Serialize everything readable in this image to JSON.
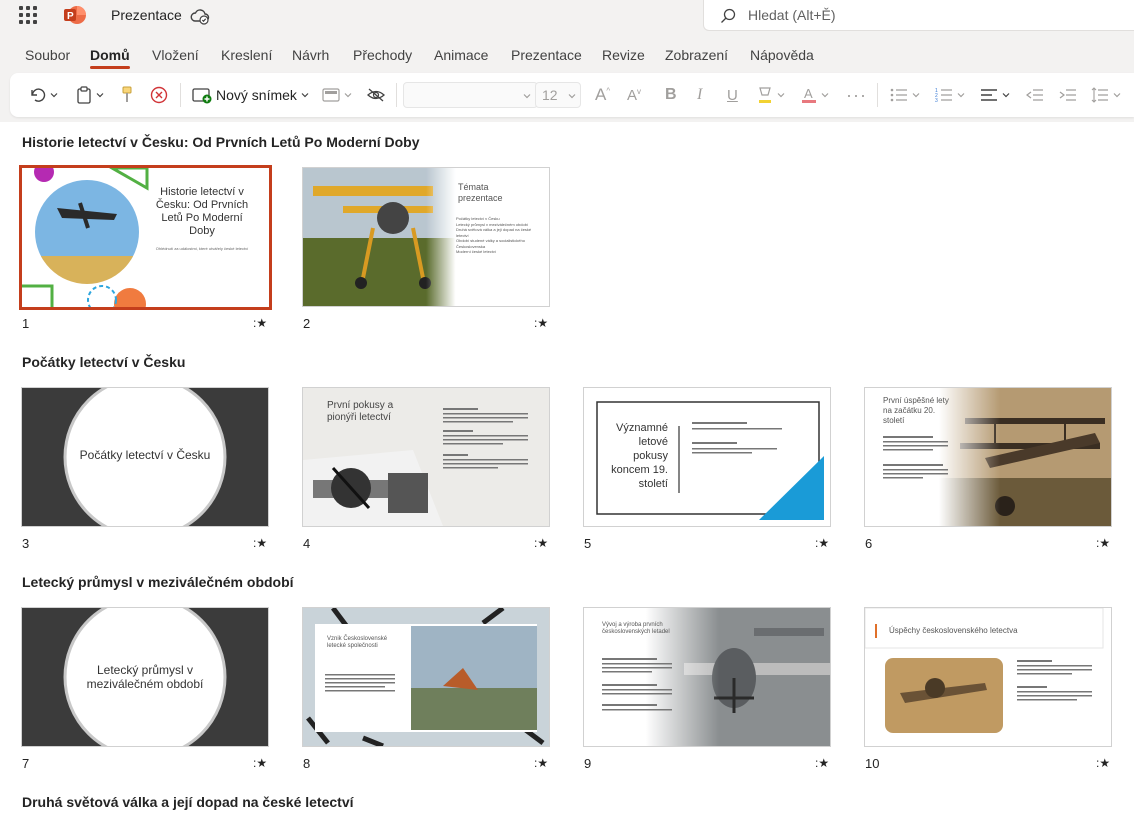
{
  "app": {
    "title": "Prezentace",
    "search_placeholder": "Hledat (Alt+Ě)"
  },
  "menu_tabs": [
    "Soubor",
    "Domů",
    "Vložení",
    "Kreslení",
    "Návrh",
    "Přechody",
    "Animace",
    "Prezentace",
    "Revize",
    "Zobrazení",
    "Nápověda"
  ],
  "active_tab": "Domů",
  "ribbon": {
    "new_slide_label": "Nový snímek",
    "font_size": "12"
  },
  "sections": [
    "Historie letectví v Česku: Od Prvních Letů Po Moderní Doby",
    "Počátky letectví v Česku",
    "Letecký průmysl v meziválečném období",
    "Druhá světová válka a její dopad na české letectví"
  ],
  "slides": [
    {
      "num": "1",
      "title": "Historie letectví v Česku: Od Prvních Letů Po Moderní Doby",
      "subtitle": "Ohlédnutí za událostmi, které utvářely české letectví"
    },
    {
      "num": "2",
      "title": "Témata prezentace",
      "bullets": [
        "Počátky letectví v Česku",
        "Letecký průmysl v meziválečném období",
        "Druhá světová válka a její dopad na české letectví",
        "Období studené války a socialistického Československa",
        "Moderní české letectví"
      ]
    },
    {
      "num": "3",
      "title": "Počátky letectví v Česku"
    },
    {
      "num": "4",
      "title": "První pokusy a pionýři letectví"
    },
    {
      "num": "5",
      "title": "Významné letové pokusy koncem 19. století"
    },
    {
      "num": "6",
      "title": "První úspěšné lety na začátku 20. století"
    },
    {
      "num": "7",
      "title": "Letecký průmysl v meziválečném období"
    },
    {
      "num": "8",
      "title": "Vznik Československé letecké společnosti"
    },
    {
      "num": "9",
      "title": "Vývoj a výroba prvních československých letadel"
    },
    {
      "num": "10",
      "title": "Úspěchy československého letectva"
    }
  ],
  "star_glyph": ":★",
  "colors": {
    "accent": "#c43e1c",
    "ppt_logo": "#c43e1c",
    "slide3_bg": "#3b3b3b",
    "slide5_accent": "#1a9bd7"
  }
}
